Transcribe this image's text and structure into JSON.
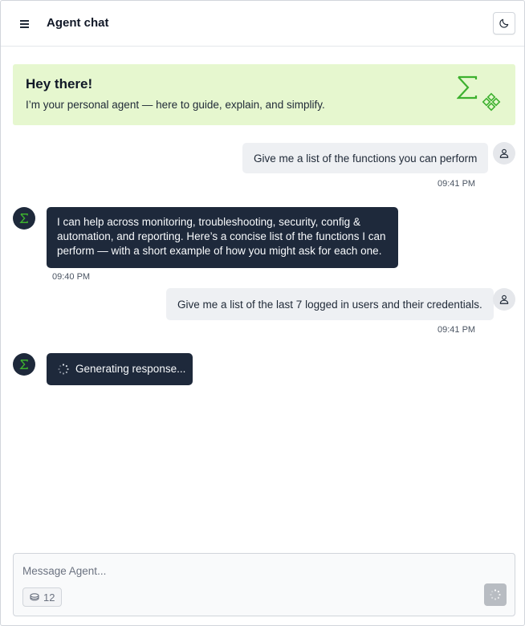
{
  "header": {
    "title": "Agent chat",
    "menu_icon": "hamburger-menu-icon",
    "theme_icon": "moon-icon"
  },
  "banner": {
    "title": "Hey there!",
    "subtitle": "I’m your personal agent — here to guide, explain, and simplify.",
    "logo_icon": "sigma-logo-icon",
    "accent_color": "#3db12f",
    "background_color": "#e6f7cf"
  },
  "messages": [
    {
      "role": "user",
      "text": "Give me a list of the functions you can perform",
      "time": "09:41 PM"
    },
    {
      "role": "agent",
      "lines": [
        "I can help across monitoring, troubleshooting, security, config &",
        "automation, and reporting. Here’s a concise list of the functions I can",
        "perform — with a short example of how you might ask for each one."
      ],
      "time": "09:40 PM"
    },
    {
      "role": "user",
      "text": "Give me a list of the last 7 logged in users and their credentials.",
      "time": "09:41 PM"
    },
    {
      "role": "agent",
      "status": "Generating response..."
    }
  ],
  "composer": {
    "placeholder": "Message Agent...",
    "token_count": "12",
    "token_icon": "coins-icon",
    "send_icon": "spinner-icon"
  },
  "colors": {
    "agent_bubble": "#1e293b",
    "user_bubble": "#eef0f3"
  }
}
